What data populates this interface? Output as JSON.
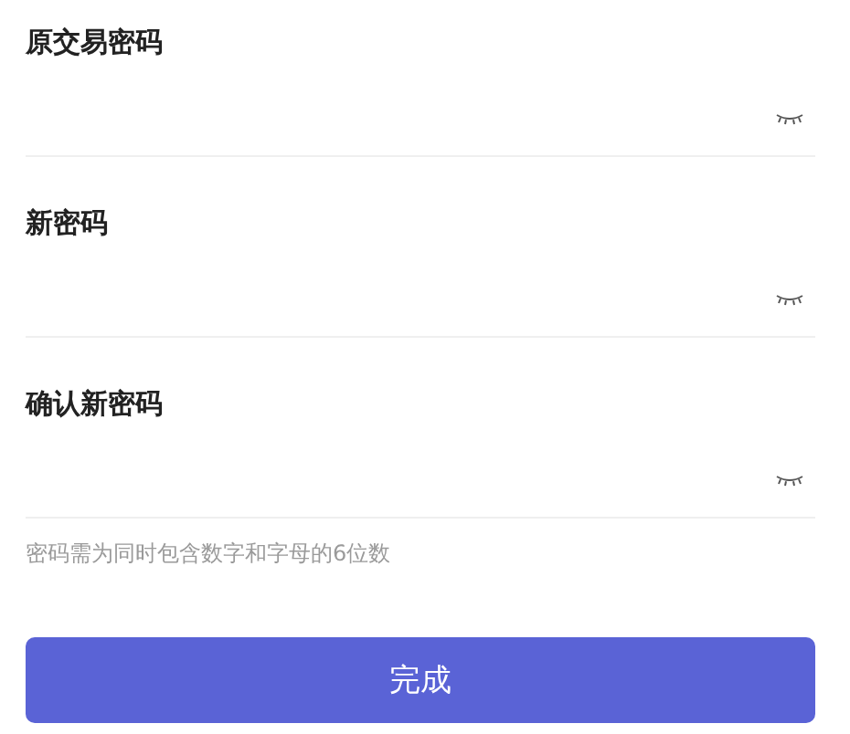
{
  "fields": [
    {
      "label": "原交易密码",
      "visible": false
    },
    {
      "label": "新密码",
      "visible": false
    },
    {
      "label": "确认新密码",
      "visible": false
    }
  ],
  "hint": "密码需为同时包含数字和字母的6位数",
  "submit_button": "完成"
}
